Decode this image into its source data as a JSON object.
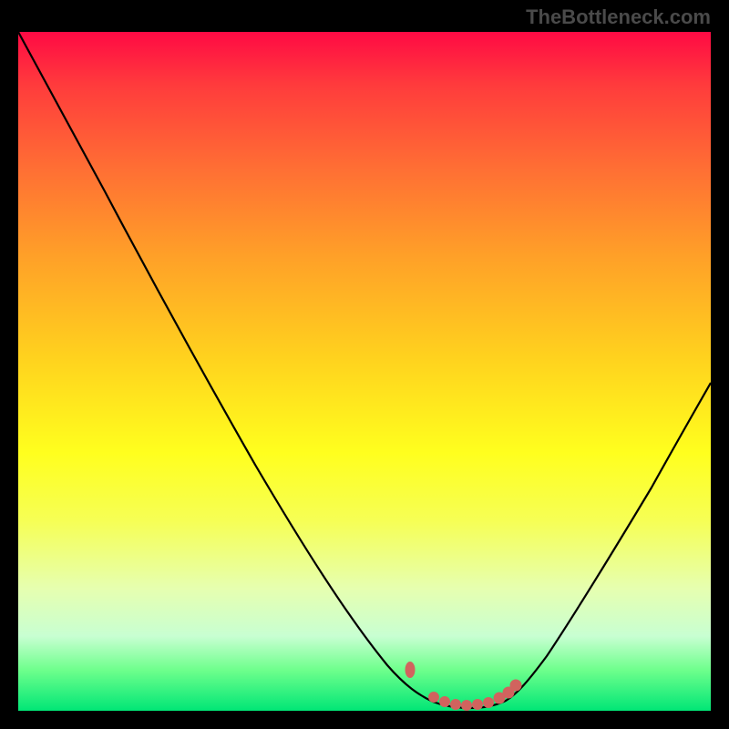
{
  "watermark": "TheBottleneck.com",
  "chart_data": {
    "type": "line",
    "title": "",
    "xlabel": "",
    "ylabel": "",
    "xlim": [
      0,
      100
    ],
    "ylim": [
      0,
      100
    ],
    "grid": false,
    "legend": false,
    "background_gradient": {
      "top": "#ff0a44",
      "bottom": "#00e676",
      "meaning": "red high to green low heat gradient"
    },
    "series": [
      {
        "name": "main-curve",
        "color": "#000000",
        "x": [
          0,
          5,
          10,
          15,
          20,
          25,
          30,
          35,
          40,
          45,
          50,
          55,
          60,
          62,
          64,
          66,
          68,
          70,
          72,
          75,
          80,
          85,
          90,
          95,
          100
        ],
        "y": [
          100,
          91,
          82,
          73,
          64,
          55,
          46,
          37,
          28,
          20,
          13,
          7,
          3,
          2,
          1.5,
          1,
          1,
          1.2,
          1.8,
          3,
          8,
          15,
          23,
          32,
          42
        ]
      },
      {
        "name": "highlight-dots",
        "color": "#d1635e",
        "type": "scatter",
        "x": [
          56.5,
          60,
          62,
          64,
          66,
          68,
          70,
          71,
          72
        ],
        "y": [
          6.5,
          2.5,
          1.8,
          1.3,
          1.0,
          1.0,
          1.3,
          1.8,
          2.8
        ]
      }
    ],
    "annotations": []
  }
}
